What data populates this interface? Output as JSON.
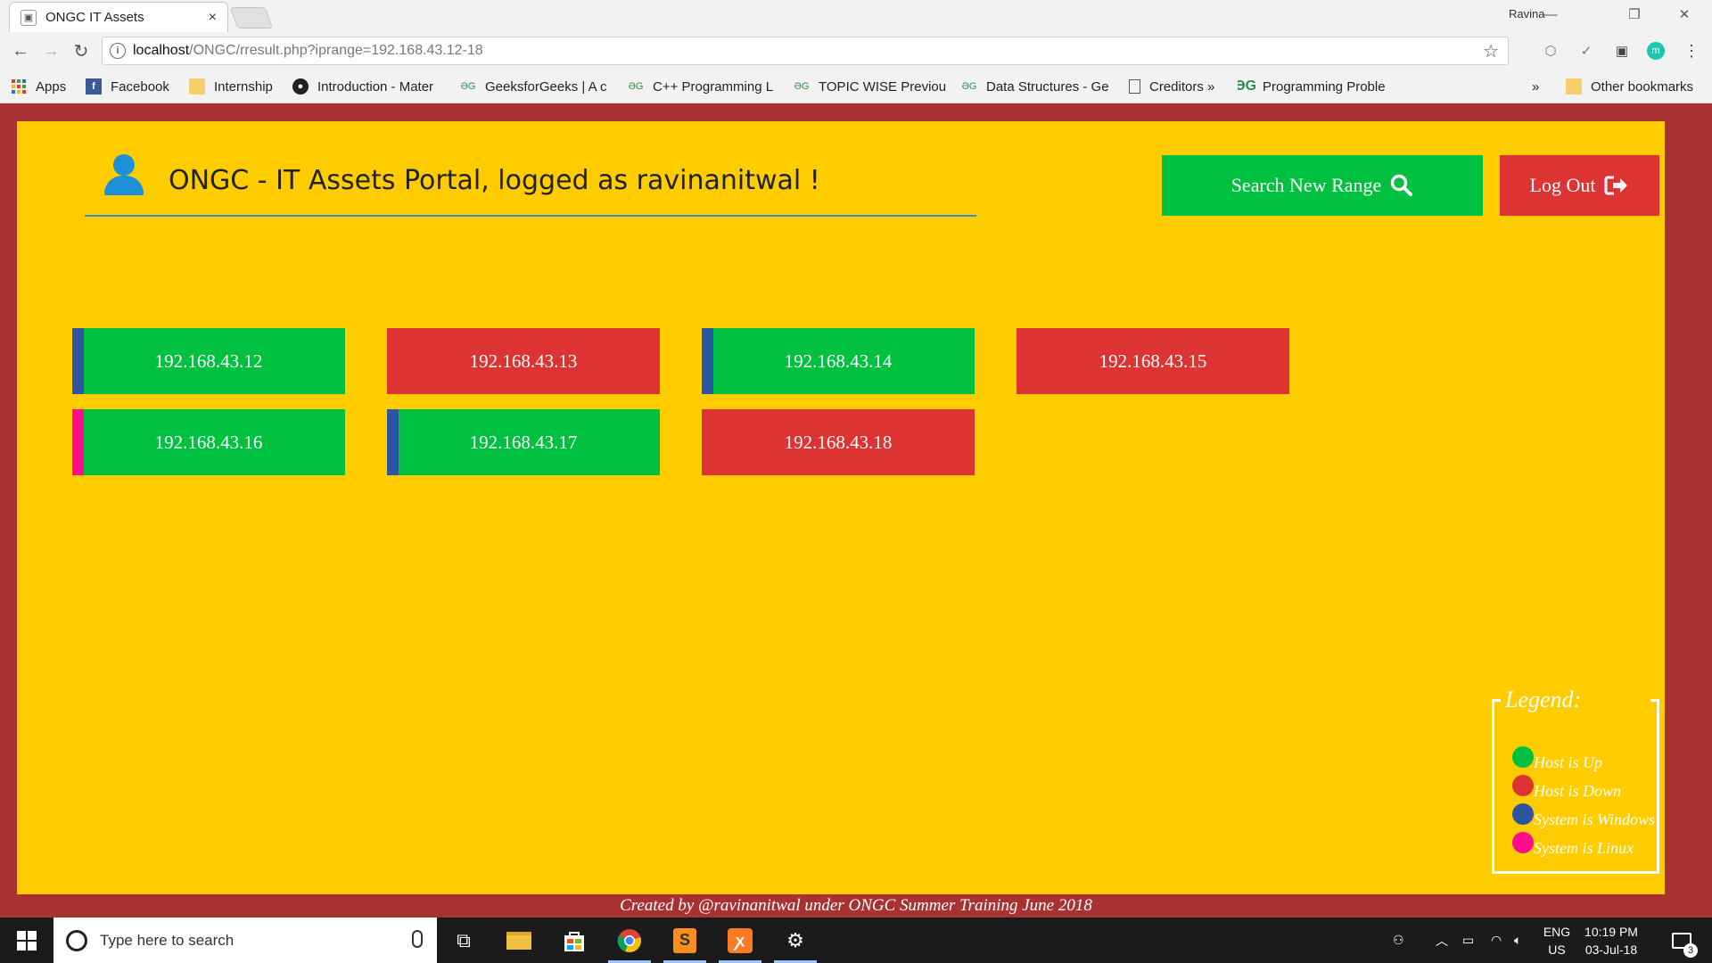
{
  "browser": {
    "tab_title": "ONGC IT Assets",
    "tab_close": "×",
    "profile_name": "Ravina",
    "url_host": "localhost",
    "url_path": "/ONGC/rresult.php?iprange=192.168.43.12-18"
  },
  "bookmarks": [
    {
      "label": "Apps",
      "icon": "apps-grid-icon"
    },
    {
      "label": "Facebook",
      "icon": "facebook-icon"
    },
    {
      "label": "Internship",
      "icon": "folder-icon"
    },
    {
      "label": "Introduction - Mater",
      "icon": "github-icon"
    },
    {
      "label": "GeeksforGeeks | A c",
      "icon": "gfg-icon"
    },
    {
      "label": "C++ Programming L",
      "icon": "gfg-icon"
    },
    {
      "label": "TOPIC WISE Previou",
      "icon": "gfg-icon"
    },
    {
      "label": "Data Structures - Ge",
      "icon": "gfg-icon"
    },
    {
      "label": "Creditors »",
      "icon": "page-icon"
    },
    {
      "label": "Programming Proble",
      "icon": "gfg-logo-icon"
    },
    {
      "label": "»",
      "icon": "more-icon"
    },
    {
      "label": "Other bookmarks",
      "icon": "folder-icon"
    }
  ],
  "portal": {
    "title": "ONGC - IT Assets Portal, logged as ravinanitwal !",
    "search_button": "Search New Range",
    "logout_button": "Log Out"
  },
  "hosts": [
    {
      "ip": "192.168.43.12",
      "status": "up",
      "os": "windows"
    },
    {
      "ip": "192.168.43.13",
      "status": "down",
      "os": ""
    },
    {
      "ip": "192.168.43.14",
      "status": "up",
      "os": "windows"
    },
    {
      "ip": "192.168.43.15",
      "status": "down",
      "os": ""
    },
    {
      "ip": "192.168.43.16",
      "status": "up",
      "os": "linux"
    },
    {
      "ip": "192.168.43.17",
      "status": "up",
      "os": "windows"
    },
    {
      "ip": "192.168.43.18",
      "status": "down",
      "os": ""
    }
  ],
  "legend": {
    "title": "Legend:",
    "items": [
      {
        "label": "Host is Up",
        "color": "#00c040"
      },
      {
        "label": "Host is Down",
        "color": "#dd3333"
      },
      {
        "label": "System is Windows",
        "color": "#2b55a0"
      },
      {
        "label": "System is Linux",
        "color": "#ff0d8c"
      }
    ]
  },
  "footer": "Created by @ravinanitwal under ONGC Summer Training June 2018",
  "colors": {
    "page_bg": "#a83232",
    "panel_bg": "#ffcc00",
    "up": "#00c040",
    "down": "#dd3333",
    "windows": "#2b55a0",
    "linux": "#ff0d8c"
  },
  "taskbar": {
    "search_placeholder": "Type here to search",
    "lang_top": "ENG",
    "lang_bottom": "US",
    "time": "10:19 PM",
    "date": "03-Jul-18",
    "notification_count": "3"
  }
}
